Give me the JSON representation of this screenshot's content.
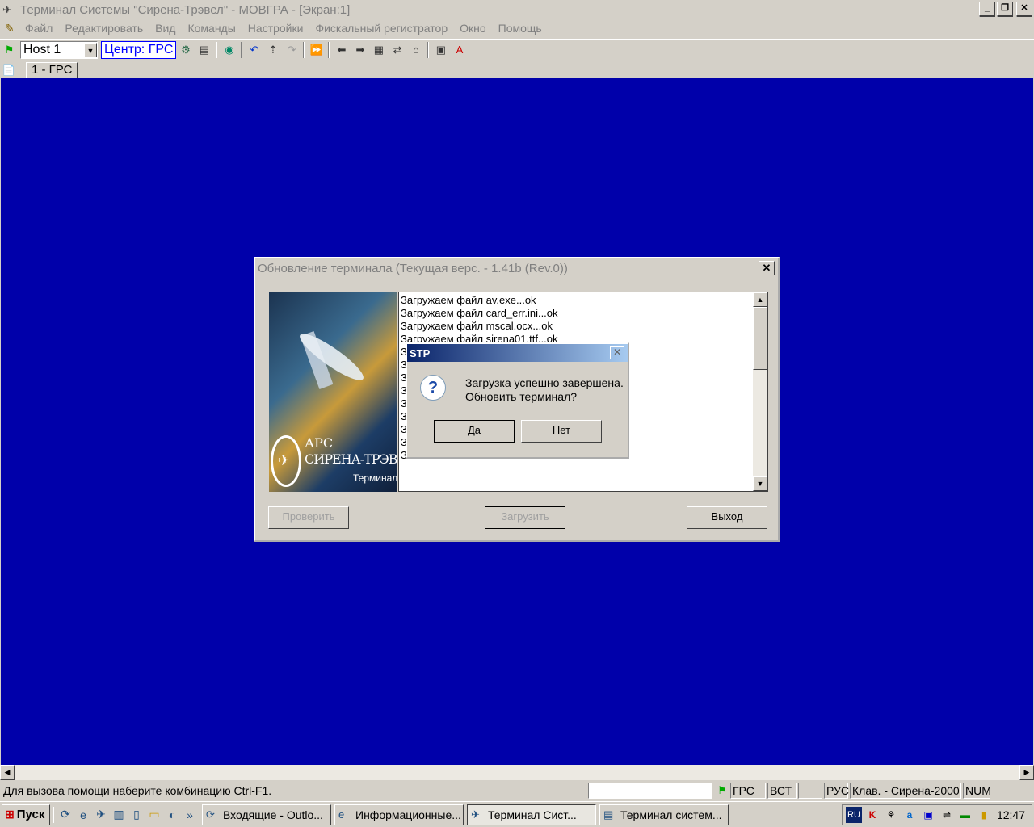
{
  "window": {
    "title": "Терминал Системы \"Сирена-Трэвел\" - МОВГРА - [Экран:1]"
  },
  "menu": {
    "items": [
      "Файл",
      "Редактировать",
      "Вид",
      "Команды",
      "Настройки",
      "Фискальный регистратор",
      "Окно",
      "Помощь"
    ]
  },
  "toolbar": {
    "host_value": "Host 1",
    "center_label": "Центр: ГРС"
  },
  "tabs": {
    "active": "1 - ГРС"
  },
  "update_dialog": {
    "title": "Обновление терминала (Текущая верс. - 1.41b (Rev.0))",
    "logo": {
      "line1": "АРС",
      "line2": "СИРЕНА-ТРЭВЕЛ",
      "line3": "Терминал"
    },
    "log": [
      "Загружаем файл av.exe...ok",
      "Загружаем файл card_err.ini...ok",
      "Загружаем файл mscal.ocx...ok",
      "Загружаем файл sirena01.ttf...ok",
      "З",
      "З",
      "З",
      "З",
      "З",
      "З",
      "З",
      "З",
      "З"
    ],
    "buttons": {
      "check": "Проверить",
      "load": "Загрузить",
      "exit": "Выход"
    }
  },
  "confirm_dialog": {
    "title": "STP",
    "message_line1": "Загрузка успешно завершена.",
    "message_line2": "Обновить терминал?",
    "yes": "Да",
    "no": "Нет"
  },
  "statusbar": {
    "text": "Для вызова помощи наберите комбинацию Ctrl-F1.",
    "panes": [
      "ГРС",
      "ВСТ",
      "",
      "РУС",
      "Клав. - Сирена-2000",
      "NUM"
    ]
  },
  "taskbar": {
    "start": "Пуск",
    "tasks": [
      "Входящие - Outlo...",
      "Информационные...",
      "Терминал Сист...",
      "Терминал систем..."
    ],
    "tray_lang": "RU",
    "clock": "12:47"
  }
}
